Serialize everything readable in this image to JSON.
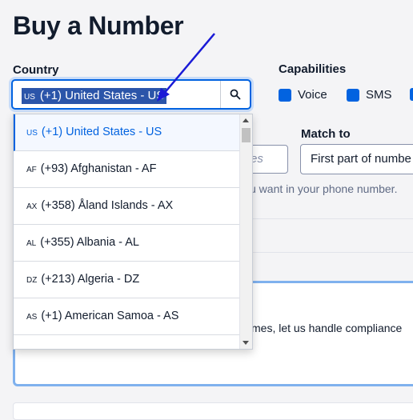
{
  "page": {
    "title": "Buy a Number"
  },
  "country": {
    "label": "Country",
    "selected_code": "US",
    "selected_text": "(+1) United States - US"
  },
  "capabilities": {
    "label": "Capabilities",
    "items": [
      {
        "label": "Voice",
        "checked": true
      },
      {
        "label": "SMS",
        "checked": true
      }
    ]
  },
  "match_to": {
    "label": "Match to",
    "value": "First part of numbe"
  },
  "search": {
    "placeholder_fragment": "es"
  },
  "help_text": "u want in your phone number.",
  "card_text": "mes, let us handle compliance",
  "dropdown": {
    "options": [
      {
        "code": "US",
        "text": "(+1) United States - US",
        "selected": true
      },
      {
        "code": "AF",
        "text": "(+93) Afghanistan - AF"
      },
      {
        "code": "AX",
        "text": "(+358) Åland Islands - AX"
      },
      {
        "code": "AL",
        "text": "(+355) Albania - AL"
      },
      {
        "code": "DZ",
        "text": "(+213) Algeria - DZ"
      },
      {
        "code": "AS",
        "text": "(+1) American Samoa - AS"
      }
    ]
  },
  "colors": {
    "accent": "#0263e0",
    "selection": "#2b55a9",
    "annotation_arrow": "#1a1ad6"
  },
  "icons": {
    "search": "search-icon",
    "arrow": "annotation-arrow-icon"
  }
}
